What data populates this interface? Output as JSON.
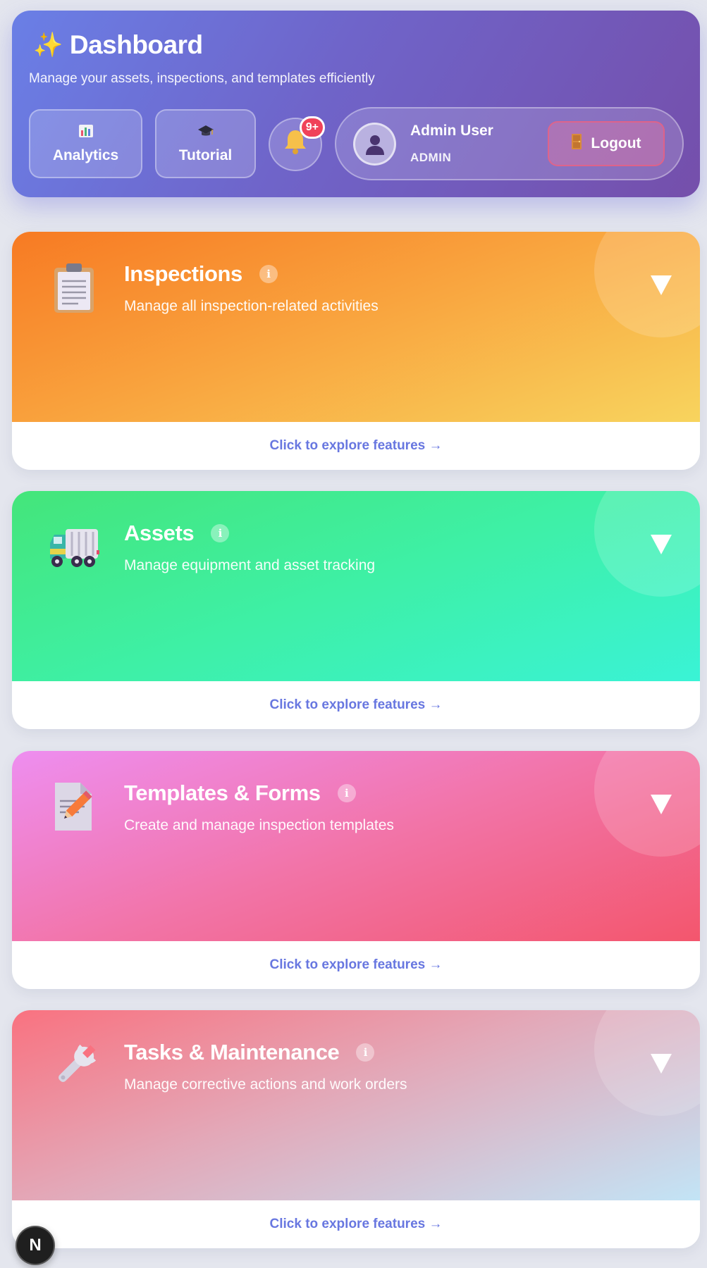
{
  "header": {
    "title": "Dashboard",
    "subtitle": "Manage your assets, inspections, and templates efficiently",
    "analytics_label": "Analytics",
    "tutorial_label": "Tutorial",
    "notification_badge": "9+",
    "user": {
      "name": "Admin User",
      "role": "ADMIN"
    },
    "logout_label": "Logout"
  },
  "cards": [
    {
      "title": "Inspections",
      "description": "Manage all inspection-related activities",
      "footer": "Click to explore features →",
      "icon": "clipboard-icon"
    },
    {
      "title": "Assets",
      "description": "Manage equipment and asset tracking",
      "footer": "Click to explore features →",
      "icon": "truck-icon"
    },
    {
      "title": "Templates & Forms",
      "description": "Create and manage inspection templates",
      "footer": "Click to explore features →",
      "icon": "document-pencil-icon"
    },
    {
      "title": "Tasks & Maintenance",
      "description": "Manage corrective actions and work orders",
      "footer": "Click to explore features →",
      "icon": "wrench-icon"
    }
  ],
  "dev_badge": "N",
  "colors": {
    "accent": "#6877e0",
    "header_gradient": [
      "#6a7fe6",
      "#754fab"
    ],
    "badge": "#f0425a"
  }
}
